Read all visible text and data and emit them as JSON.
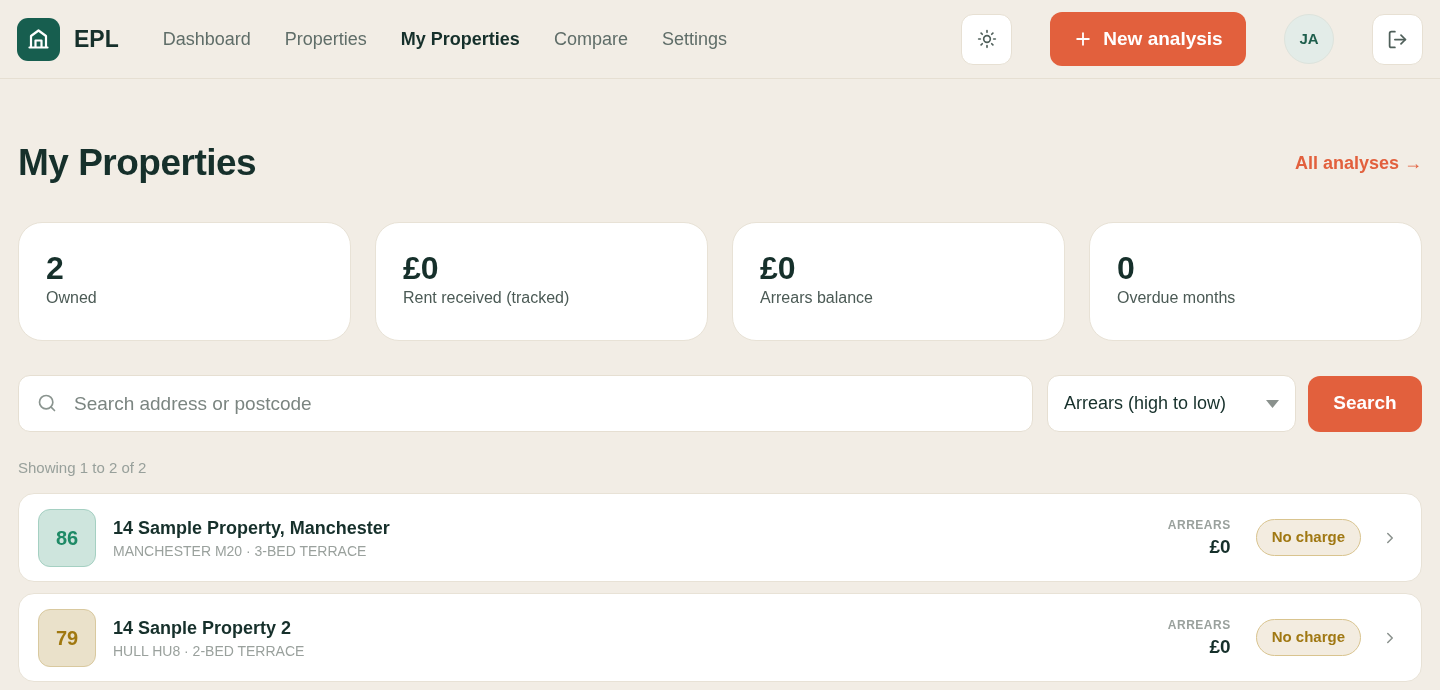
{
  "header": {
    "logo_text": "EPL",
    "nav": [
      {
        "label": "Dashboard",
        "selected": false
      },
      {
        "label": "Properties",
        "selected": false
      },
      {
        "label": "My Properties",
        "selected": true
      },
      {
        "label": "Compare",
        "selected": false
      },
      {
        "label": "Settings",
        "selected": false
      }
    ],
    "new_analysis_button": "New analysis",
    "avatar_initials": "JA"
  },
  "page": {
    "title": "My Properties",
    "all_analyses_link": "All analyses →"
  },
  "stats": [
    {
      "value": "2",
      "label": "Owned"
    },
    {
      "value": "£0",
      "label": "Rent received (tracked)"
    },
    {
      "value": "£0",
      "label": "Arrears balance"
    },
    {
      "value": "0",
      "label": "Overdue months"
    }
  ],
  "search": {
    "placeholder": "Search address or postcode",
    "sort": "Arrears (high to low)",
    "button": "Search"
  },
  "results_summary": "Showing 1 to 2 of 2",
  "properties": [
    {
      "score": "86",
      "color": "#1e8a66",
      "title": "14 Sample Property, Manchester",
      "subtitle": "MANCHESTER M20 · 3-BED TERRACE",
      "arrears_label": "ARREARS",
      "arrears": "£0",
      "status": "No charge"
    },
    {
      "score": "79",
      "color": "#a07810",
      "title": "14 Sanple Property 2",
      "subtitle": "HULL HU8 · 2-BED TERRACE",
      "arrears_label": "ARREARS",
      "arrears": "£0",
      "status": "No charge"
    }
  ]
}
